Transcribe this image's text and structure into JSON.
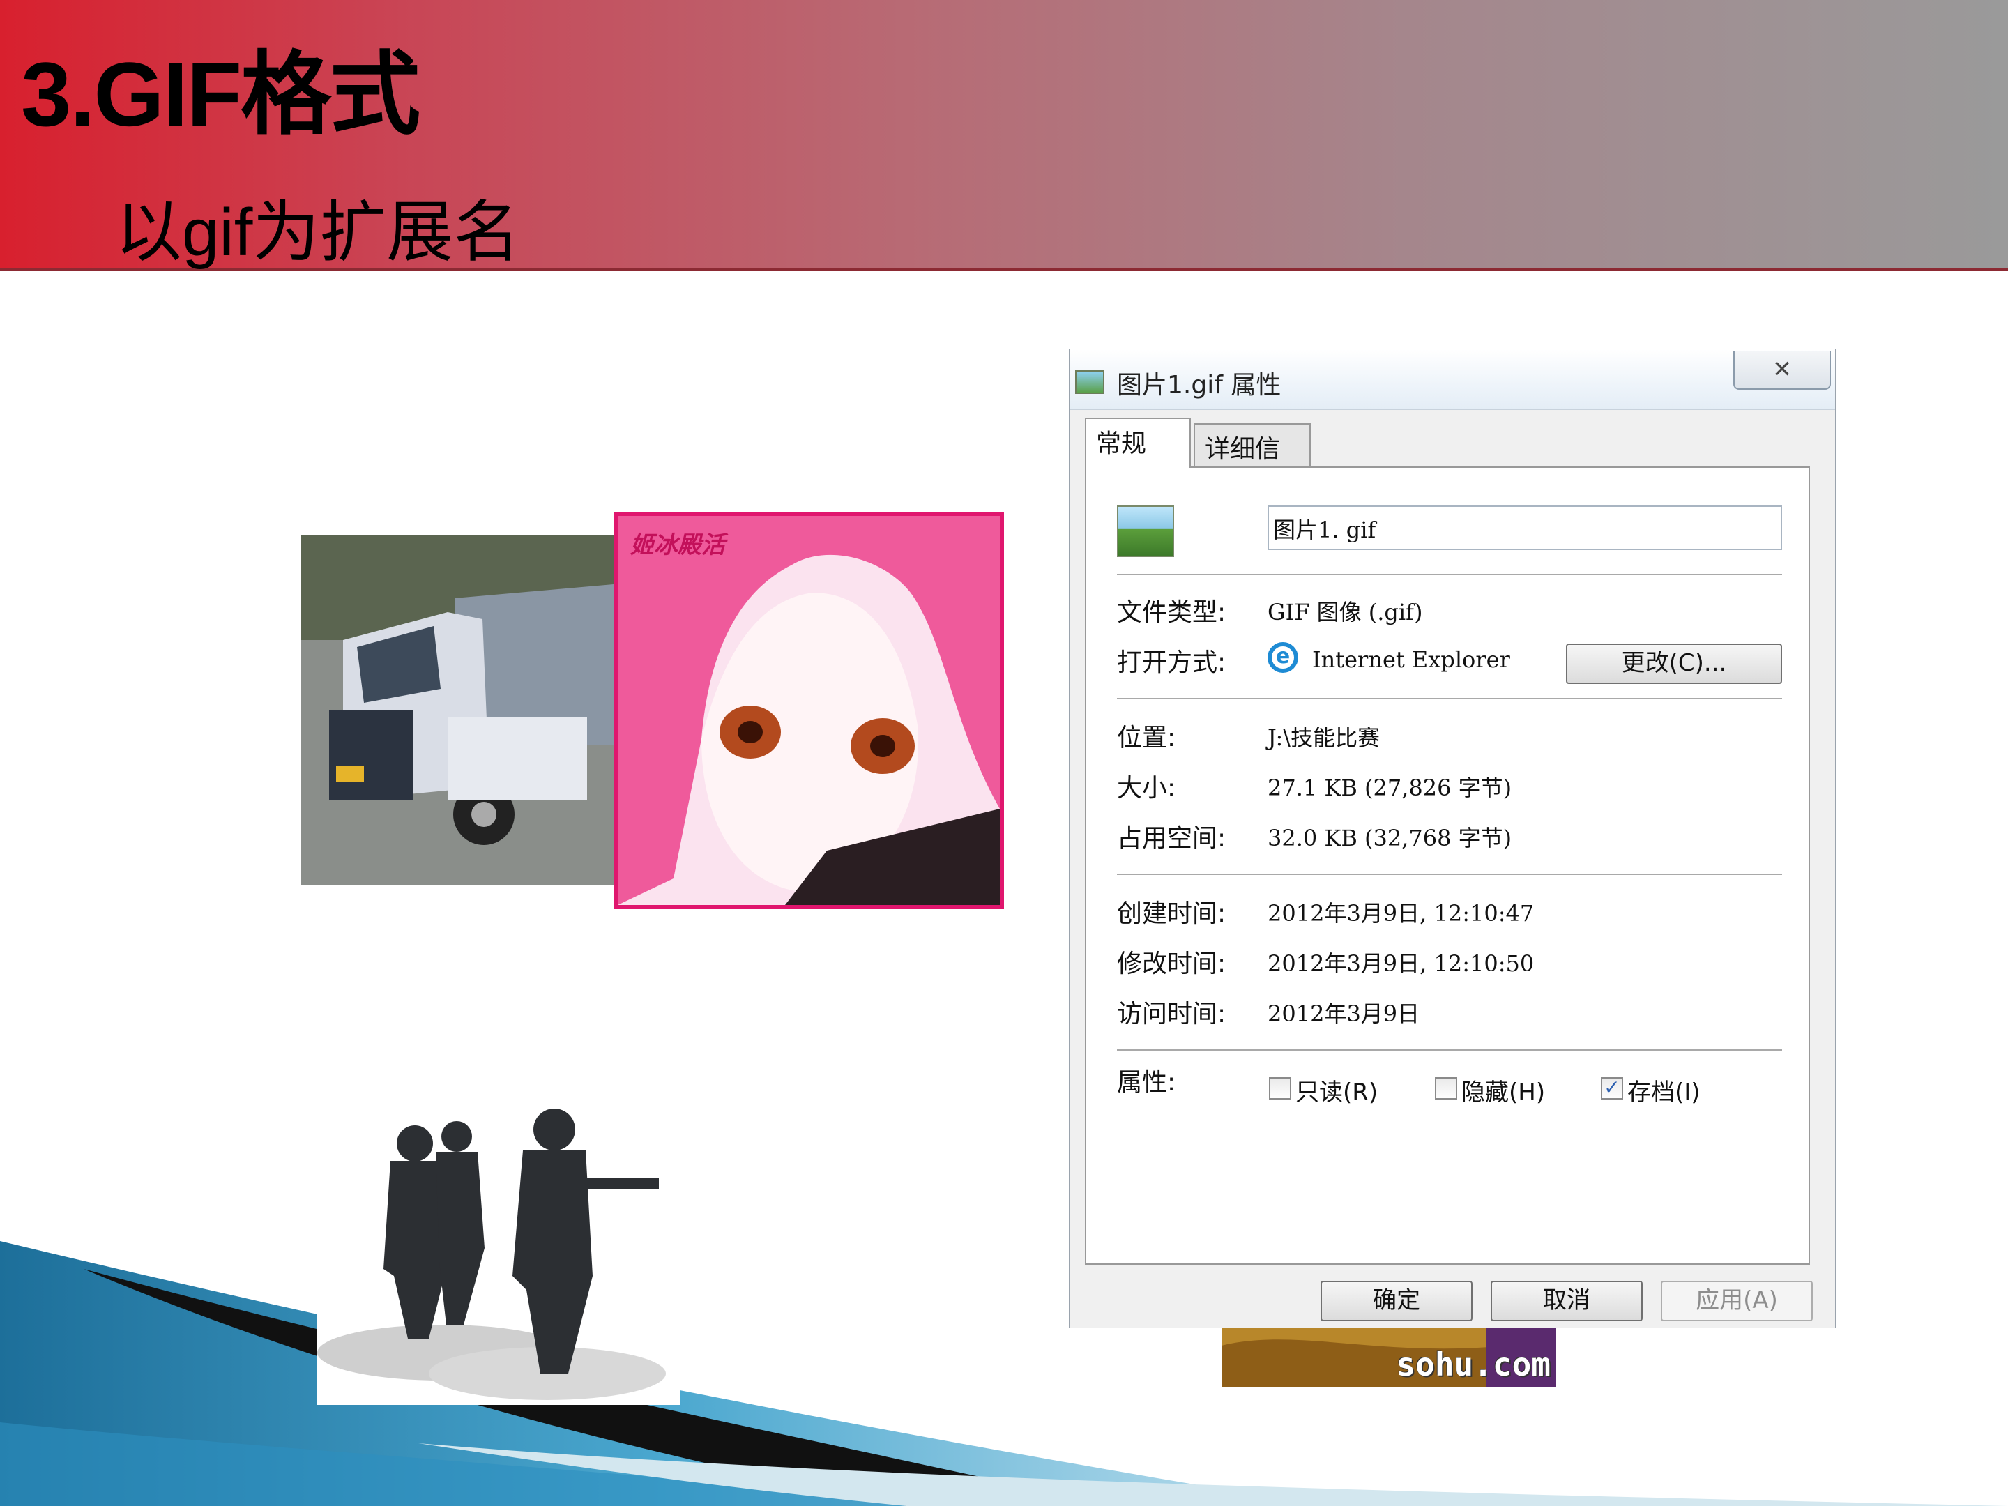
{
  "slide": {
    "title": "3.GIF格式",
    "subtitle": "以gif为扩展名"
  },
  "images": {
    "anime_watermark": "姬冰殿活",
    "sohu_logo": "sohu.com"
  },
  "dialog": {
    "title": "图片1.gif 属性",
    "close_glyph": "✕",
    "tabs": [
      "常规",
      "详细信息"
    ],
    "filename": "图片1. gif",
    "file_type_label": "文件类型:",
    "file_type_value": "GIF 图像 (.gif)",
    "open_with_label": "打开方式:",
    "open_with_value": "Internet Explorer",
    "change_button": "更改(C)...",
    "location_label": "位置:",
    "location_value": "J:\\技能比赛",
    "size_label": "大小:",
    "size_value": "27.1 KB (27,826 字节)",
    "disk_size_label": "占用空间:",
    "disk_size_value": "32.0 KB (32,768 字节)",
    "created_label": "创建时间:",
    "created_value": "2012年3月9日, 12:10:47",
    "modified_label": "修改时间:",
    "modified_value": "2012年3月9日, 12:10:50",
    "accessed_label": "访问时间:",
    "accessed_value": "2012年3月9日",
    "attributes_label": "属性:",
    "attributes": [
      {
        "label": "只读(R)",
        "checked": false
      },
      {
        "label": "隐藏(H)",
        "checked": false
      },
      {
        "label": "存档(I)",
        "checked": true
      }
    ],
    "ok_button": "确定",
    "cancel_button": "取消",
    "apply_button": "应用(A)"
  },
  "colors": {
    "header_red": "#d8202e",
    "header_gray": "#9a9a9a",
    "anime_border": "#e0166e",
    "sweep_dark": "#111111",
    "sweep_blue": "#2a8ab8"
  }
}
